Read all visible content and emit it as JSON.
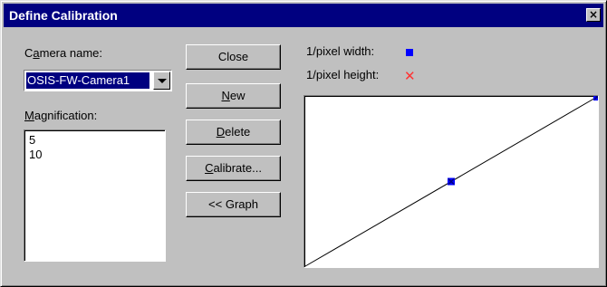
{
  "window": {
    "title": "Define Calibration",
    "close_glyph": "×"
  },
  "camera": {
    "label_prefix": "C",
    "label_underline": "a",
    "label_rest": "mera name:",
    "value": "OSIS-FW-Camera1"
  },
  "magnification": {
    "label_underline": "M",
    "label_rest": "agnification:",
    "items": [
      "5",
      "10"
    ]
  },
  "buttons": {
    "close": "Close",
    "new_u": "N",
    "new_rest": "ew",
    "delete_u": "D",
    "delete_rest": "elete",
    "calibrate_u": "C",
    "calibrate_rest": "alibrate...",
    "graph": "<< Graph"
  },
  "legend": {
    "width_label": "1/pixel width:",
    "height_label": "1/pixel height:",
    "width_color": "#0000ff",
    "height_color": "#ff3333",
    "width_marker": "square-marker",
    "height_marker": "x-marker"
  },
  "chart_data": {
    "type": "line",
    "x": [
      5,
      10
    ],
    "series": [
      {
        "name": "1/pixel width",
        "values": [
          5,
          10
        ]
      },
      {
        "name": "1/pixel height",
        "values": [
          5,
          10
        ]
      }
    ],
    "xlim": [
      0,
      10
    ],
    "ylim": [
      0,
      10
    ],
    "grid": false
  }
}
